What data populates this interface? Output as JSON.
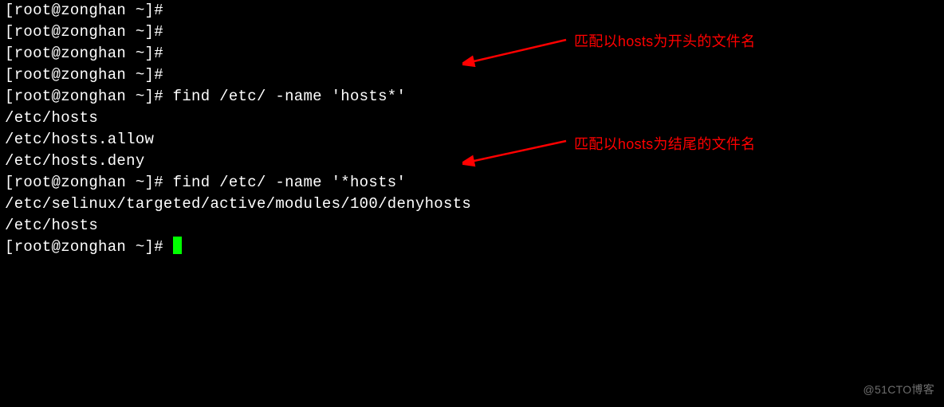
{
  "terminal": {
    "prompt_partial_top": "[root@zonghan ~]#",
    "prompts_empty": [
      "[root@zonghan ~]# ",
      "[root@zonghan ~]# ",
      "[root@zonghan ~]# "
    ],
    "cmd1_prompt": "[root@zonghan ~]# ",
    "cmd1": "find /etc/ -name 'hosts*'",
    "out1": [
      "/etc/hosts",
      "/etc/hosts.allow",
      "/etc/hosts.deny"
    ],
    "cmd2_prompt": "[root@zonghan ~]# ",
    "cmd2": "find /etc/ -name '*hosts'",
    "out2": [
      "/etc/selinux/targeted/active/modules/100/denyhosts",
      "/etc/hosts"
    ],
    "final_prompt": "[root@zonghan ~]# "
  },
  "annotations": {
    "starts_with": "匹配以hosts为开头的文件名",
    "ends_with": "匹配以hosts为结尾的文件名"
  },
  "watermark": "@51CTO博客",
  "chart_data": null
}
